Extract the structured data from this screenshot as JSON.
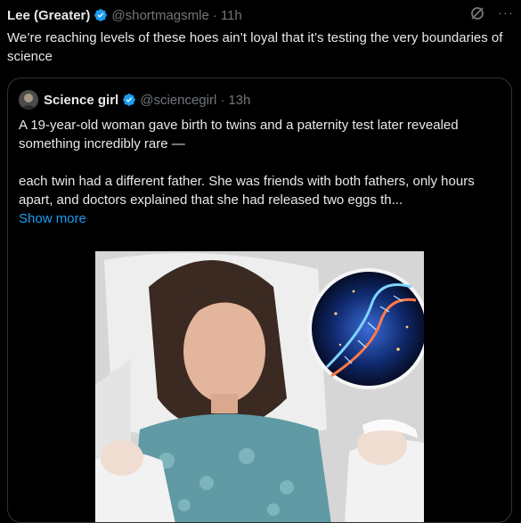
{
  "tweet": {
    "author_name": "Lee (Greater)",
    "author_handle": "@shortmagsmle",
    "separator": "·",
    "time": "11h",
    "text": "We’re reaching levels of these hoes ain’t loyal that it’s testing the very boundaries of science"
  },
  "quote": {
    "author_name": "Science girl",
    "author_handle": "@sciencegirl",
    "separator": "·",
    "time": "13h",
    "paragraph1": "A 19-year-old woman gave birth to twins and a paternity test later revealed something incredibly rare —",
    "paragraph2": "each twin had a different father. She was friends with both fathers, only hours apart, and doctors explained that she had released two eggs th...",
    "show_more": "Show more"
  },
  "icons": {
    "verified": "verified-badge-icon",
    "grok": "grok-icon",
    "more": "more-options-icon"
  },
  "colors": {
    "background": "#000000",
    "text": "#e7e9ea",
    "muted": "#71767b",
    "accent": "#1d9bf0",
    "border": "#2f3336"
  }
}
